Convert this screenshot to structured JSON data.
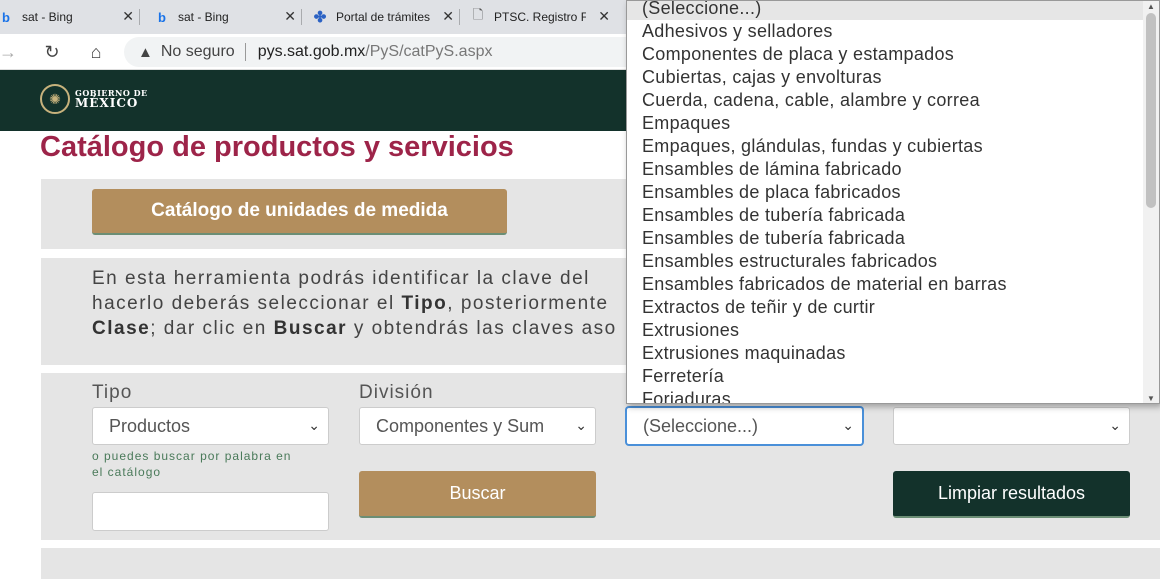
{
  "browser": {
    "tabs": [
      {
        "label": "sat - Bing",
        "icon": "bing-icon"
      },
      {
        "label": "sat - Bing",
        "icon": "bing-icon"
      },
      {
        "label": "Portal de trámites",
        "icon": "portal-icon"
      },
      {
        "label": "PTSC. Registro Fis",
        "icon": "document-icon"
      }
    ],
    "close_glyph": "✕",
    "security_label": "No seguro",
    "url_host": "pys.sat.gob.mx",
    "url_path": "/PyS/catPyS.aspx"
  },
  "header": {
    "logo_small": "GOBIERNO DE",
    "logo_big": "MÉXICO"
  },
  "page": {
    "title": "Catálogo de productos y servicios",
    "unidades_button": "Catálogo de unidades de medida",
    "description": {
      "line1": "En esta herramienta podrás identificar la clave del",
      "line2_a": "hacerlo deberás seleccionar el ",
      "line2_b": "Tipo",
      "line2_c": ", posteriormente",
      "line3_a": "Clase",
      "line3_b": "; dar clic en ",
      "line3_c": "Buscar",
      "line3_d": " y obtendrás las claves aso"
    },
    "form": {
      "tipo_label": "Tipo",
      "tipo_value": "Productos",
      "division_label": "División",
      "division_value": "Componentes y Sum",
      "grupo_value": "(Seleccione...)",
      "clase_value": "",
      "hint": "o puedes buscar por palabra en el catálogo",
      "hint_line1": "o puedes buscar por palabra en",
      "hint_line2": "el catálogo",
      "search_value": "",
      "buscar_button": "Buscar",
      "limpiar_button": "Limpiar resultados"
    }
  },
  "dropdown": {
    "items": [
      "(Seleccione...)",
      "Adhesivos y selladores",
      "Componentes de placa y estampados",
      "Cubiertas, cajas y envolturas",
      "Cuerda, cadena, cable, alambre y correa",
      "Empaques",
      "Empaques, glándulas, fundas y cubiertas",
      "Ensambles de lámina fabricado",
      "Ensambles de placa fabricados",
      "Ensambles de tubería fabricada",
      "Ensambles de tubería fabricada",
      "Ensambles estructurales fabricados",
      "Ensambles fabricados de material en barras",
      "Extractos de teñir y de curtir",
      "Extrusiones",
      "Extrusiones maquinadas",
      "Ferretería",
      "Forjaduras"
    ],
    "selected_index": 0
  }
}
